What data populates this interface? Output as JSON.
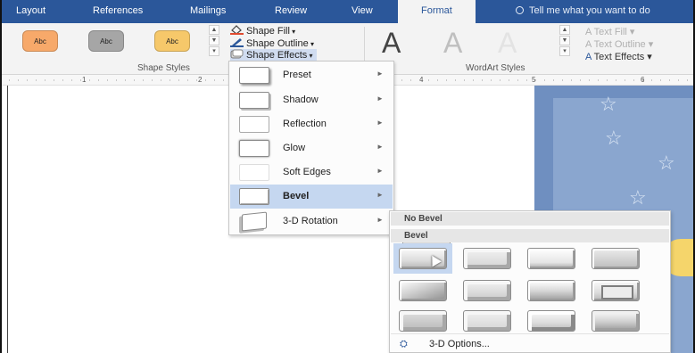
{
  "ribbon_tabs": [
    "Layout",
    "References",
    "Mailings",
    "Review",
    "View",
    "Format"
  ],
  "tell_me": "Tell me what you want to do",
  "shape_styles": {
    "preset_label": "Abc",
    "shape_fill": "Shape Fill",
    "shape_outline": "Shape Outline",
    "shape_effects": "Shape Effects",
    "group_label": "Shape Styles"
  },
  "wordart": {
    "letter": "A",
    "text_fill": "Text Fill",
    "text_outline": "Text Outline",
    "text_effects": "Text Effects",
    "group_label": "WordArt Styles"
  },
  "ruler_numbers": [
    "1",
    "2",
    "4",
    "5",
    "6"
  ],
  "shape_effects_menu": [
    {
      "label": "Preset",
      "icon": "preset-thumbnail"
    },
    {
      "label": "Shadow",
      "icon": "shadow-thumbnail"
    },
    {
      "label": "Reflection",
      "icon": "reflection-thumbnail"
    },
    {
      "label": "Glow",
      "icon": "glow-thumbnail"
    },
    {
      "label": "Soft Edges",
      "icon": "soft-edges-thumbnail"
    },
    {
      "label": "Bevel",
      "icon": "bevel-thumbnail"
    },
    {
      "label": "3-D Rotation",
      "icon": "3d-rotation-thumbnail"
    }
  ],
  "highlighted_menu_item": "Bevel",
  "bevel_submenu": {
    "no_bevel_header": "No Bevel",
    "bevel_header": "Bevel",
    "options_label": "3-D Options...",
    "selected_index": 0
  },
  "colors": {
    "ribbon_blue": "#2b579a",
    "menu_highlight": "#c5d7f0",
    "style_orange": "#f7a96a",
    "style_gray": "#a6a6a6",
    "style_gold": "#f6c86a",
    "document_shape_blue": "#6f8fc0",
    "document_shape_yellow": "#f5d56b"
  }
}
